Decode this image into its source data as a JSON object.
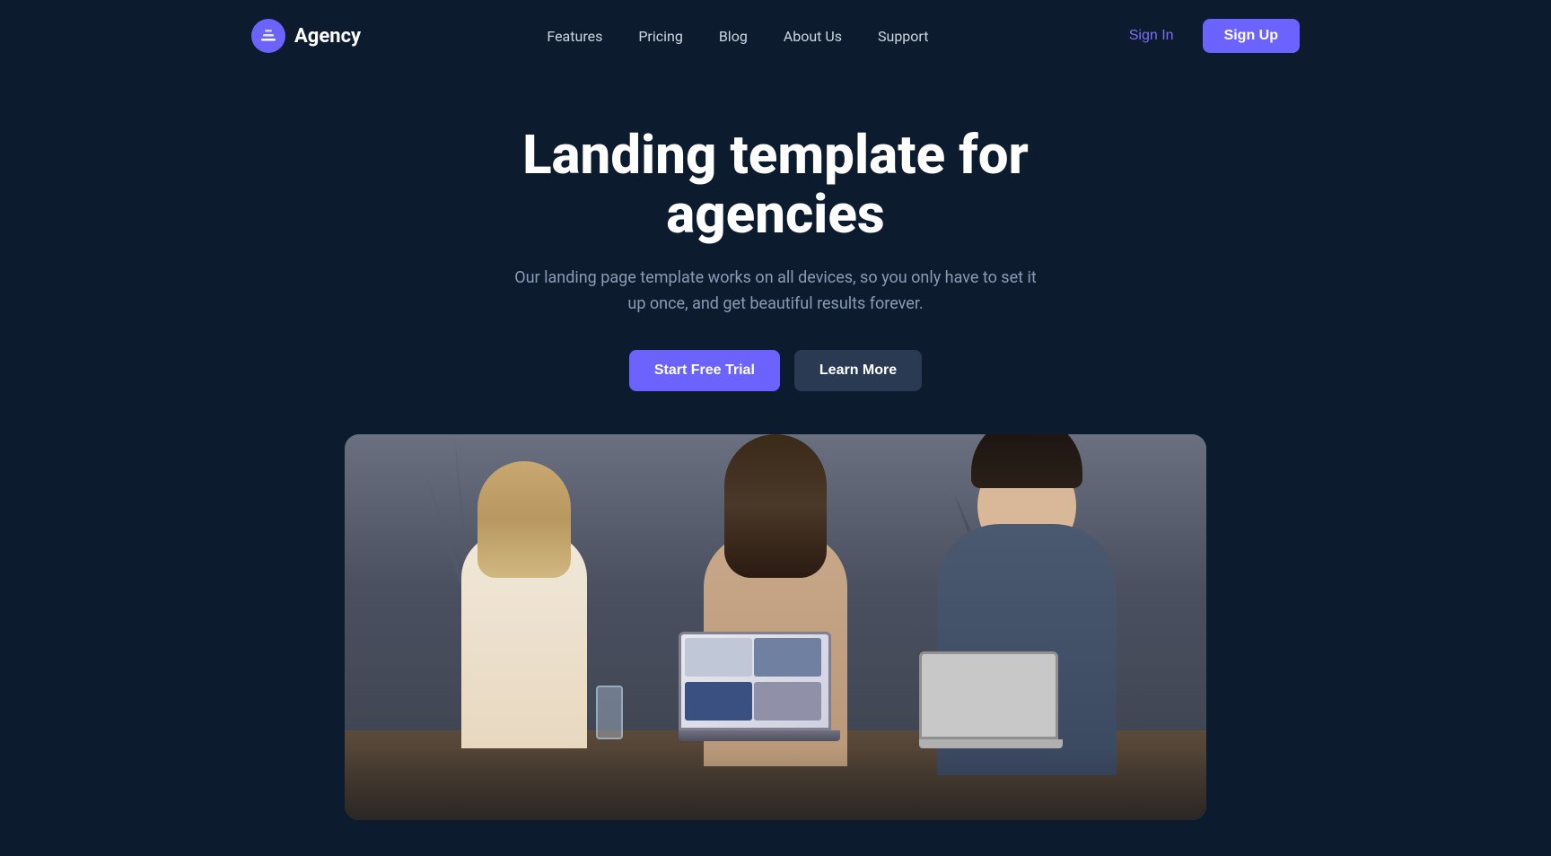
{
  "brand": {
    "logo_text": "Agency",
    "logo_icon": "layers-icon"
  },
  "nav": {
    "links": [
      {
        "id": "features",
        "label": "Features"
      },
      {
        "id": "pricing",
        "label": "Pricing"
      },
      {
        "id": "blog",
        "label": "Blog"
      },
      {
        "id": "about",
        "label": "About Us"
      },
      {
        "id": "support",
        "label": "Support"
      }
    ],
    "signin_label": "Sign In",
    "signup_label": "Sign Up"
  },
  "hero": {
    "title": "Landing template for agencies",
    "subtitle": "Our landing page template works on all devices, so you only have to set it up once, and get beautiful results forever.",
    "cta_primary": "Start Free Trial",
    "cta_secondary": "Learn More"
  },
  "colors": {
    "bg": "#0d1b2e",
    "accent": "#6c63ff",
    "text_muted": "#8a9bb5"
  }
}
